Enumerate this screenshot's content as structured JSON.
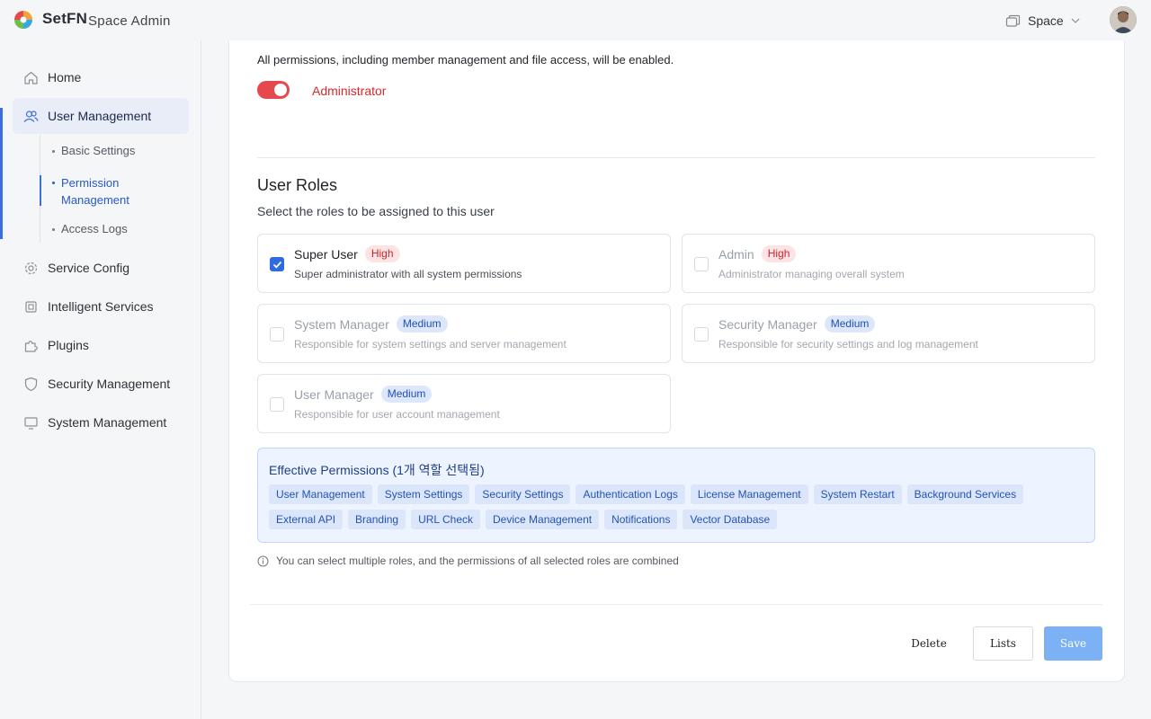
{
  "header": {
    "brand": "SetFN",
    "subtitle": "Space Admin",
    "space_label": "Space",
    "icons": {
      "logo": "setfn-logo",
      "space": "window-stack-icon",
      "chevron": "chevron-down-icon"
    }
  },
  "sidebar": {
    "items": [
      {
        "label": "Home",
        "icon": "home-icon"
      },
      {
        "label": "User Management",
        "icon": "users-icon",
        "active": true
      },
      {
        "label": "Service Config",
        "icon": "gear-icon"
      },
      {
        "label": "Intelligent Services",
        "icon": "chip-icon"
      },
      {
        "label": "Plugins",
        "icon": "puzzle-icon"
      },
      {
        "label": "Security Management",
        "icon": "shield-icon"
      },
      {
        "label": "System Management",
        "icon": "monitor-icon"
      }
    ],
    "sub_items": [
      {
        "label": "Basic Settings"
      },
      {
        "label": "Permission Management",
        "active": true
      },
      {
        "label": "Access Logs"
      }
    ]
  },
  "main": {
    "admin_desc": "All permissions, including member management and file access, will be enabled.",
    "admin_toggle_label": "Administrator",
    "admin_toggle_on": true,
    "roles_title": "User Roles",
    "roles_subtitle": "Select the roles to be assigned to this user",
    "roles": [
      {
        "name": "Super User",
        "level": "High",
        "desc": "Super administrator with all system permissions",
        "checked": true
      },
      {
        "name": "Admin",
        "level": "High",
        "desc": "Administrator managing overall system",
        "checked": false
      },
      {
        "name": "System Manager",
        "level": "Medium",
        "desc": "Responsible for system settings and server management",
        "checked": false
      },
      {
        "name": "Security Manager",
        "level": "Medium",
        "desc": "Responsible for security settings and log management",
        "checked": false
      },
      {
        "name": "User Manager",
        "level": "Medium",
        "desc": "Responsible for user account management",
        "checked": false
      }
    ],
    "effective_title": "Effective Permissions (1개 역할 선택됨)",
    "permissions": [
      "User Management",
      "System Settings",
      "Security Settings",
      "Authentication Logs",
      "License Management",
      "System Restart",
      "Background Services",
      "External API",
      "Branding",
      "URL Check",
      "Device Management",
      "Notifications",
      "Vector Database"
    ],
    "hint": "You can select multiple roles, and the permissions of all selected roles are combined"
  },
  "footer": {
    "delete_label": "Delete",
    "lists_label": "Lists",
    "save_label": "Save"
  },
  "colors": {
    "accent": "#3b6fe0",
    "danger": "#e5484d",
    "save_button": "#7cb1f6"
  }
}
